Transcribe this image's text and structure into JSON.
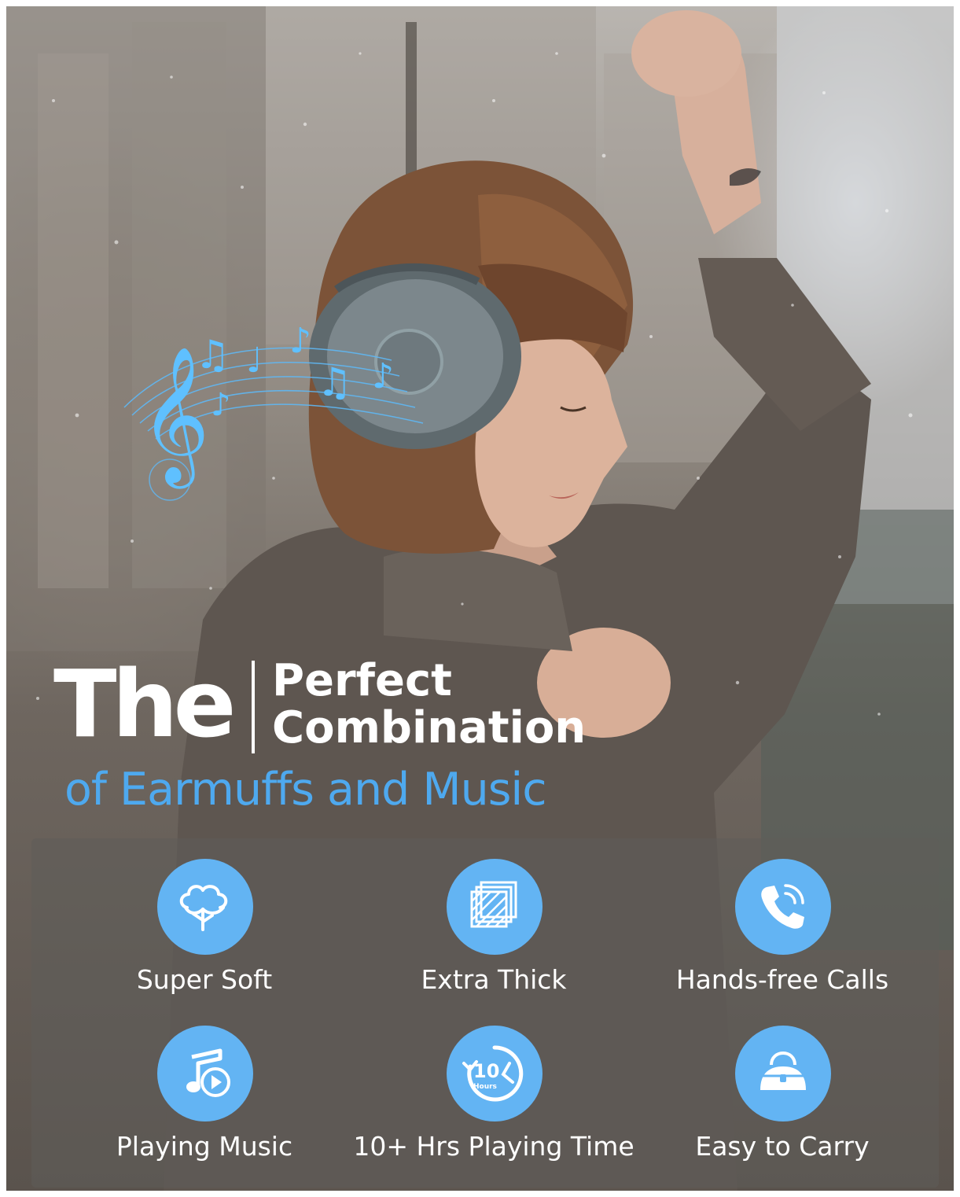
{
  "headline": {
    "the": "The",
    "perfect": "Perfect",
    "combination": "Combination",
    "subtitle": "of Earmuffs and Music"
  },
  "features": [
    {
      "label": "Super Soft",
      "icon": "cotton-icon"
    },
    {
      "label": "Extra Thick",
      "icon": "layers-icon"
    },
    {
      "label": "Hands-free Calls",
      "icon": "phone-call-icon"
    },
    {
      "label": "Playing Music",
      "icon": "music-play-icon"
    },
    {
      "label": "10+ Hrs Playing Time",
      "icon": "ten-hours-clock-icon",
      "icon_text_top": "10",
      "icon_text_bottom": "Hours"
    },
    {
      "label": "Easy to Carry",
      "icon": "handbag-icon"
    }
  ],
  "colors": {
    "accent_blue": "#4ea9ef",
    "icon_circle": "#63b4f3",
    "text": "#ffffff"
  }
}
